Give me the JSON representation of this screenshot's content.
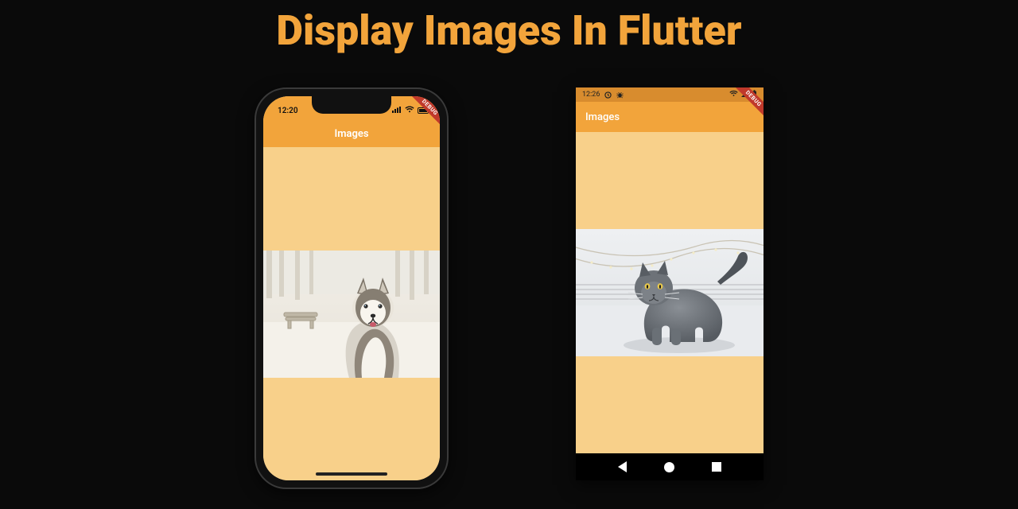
{
  "title": "Display Images In Flutter",
  "debug_label": "DEBUG",
  "colors": {
    "accent": "#f2a43b",
    "accent_dark": "#d88c2e",
    "body_bg": "#f8d08a",
    "banner_title": "#f2a43b"
  },
  "ios": {
    "status_time": "12:20",
    "appbar_title": "Images",
    "image_alt": "Husky dog sitting in snowy park with bench"
  },
  "android": {
    "status_time": "12:26",
    "appbar_title": "Images",
    "image_alt": "Grey British Shorthair cat walking on icy deck with string lights",
    "nav": {
      "back": "back",
      "home": "home",
      "recents": "recents"
    }
  }
}
